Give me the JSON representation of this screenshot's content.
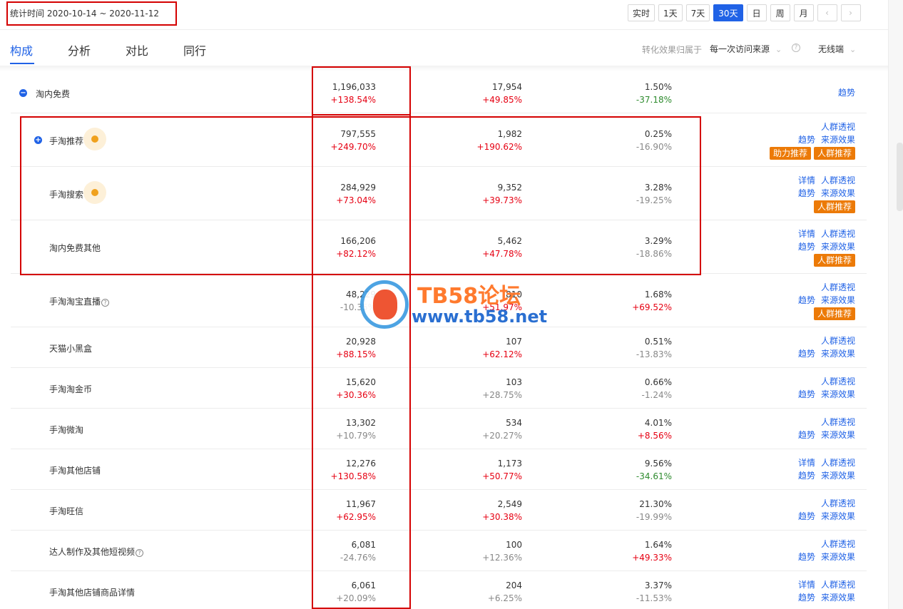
{
  "header": {
    "date_label": "统计时间 2020-10-14 ~ 2020-11-12",
    "period_buttons": [
      "实时",
      "1天",
      "7天",
      "30天",
      "日",
      "周",
      "月"
    ],
    "active_period": "30天",
    "prev_icon": "chevron-left-icon",
    "next_icon": "chevron-right-icon"
  },
  "tabs": [
    "构成",
    "分析",
    "对比",
    "同行"
  ],
  "active_tab": "构成",
  "attribution": {
    "label": "转化效果归属于",
    "value": "每一次访问来源",
    "device": "无线端"
  },
  "colors": {
    "accent": "#2062e6",
    "increase": "#e60012",
    "decrease": "#2e8b2e",
    "badge": "#ec7a07",
    "highlight": "#d40000"
  },
  "rows": [
    {
      "name": "淘内免费",
      "v1": "1,196,033",
      "c1": "+138.54%",
      "v2": "17,954",
      "c2": "+49.85%",
      "v3": "1.50%",
      "c3": "-37.18%",
      "actions": [
        "趋势"
      ]
    },
    {
      "name": "手淘推荐",
      "v1": "797,555",
      "c1": "+249.70%",
      "v2": "1,982",
      "c2": "+190.62%",
      "v3": "0.25%",
      "c3": "-16.90%",
      "actions": [
        "人群透视",
        "趋势",
        "来源效果"
      ],
      "badges": [
        "助力推荐",
        "人群推荐"
      ]
    },
    {
      "name": "手淘搜索",
      "v1": "284,929",
      "c1": "+73.04%",
      "v2": "9,352",
      "c2": "+39.73%",
      "v3": "3.28%",
      "c3": "-19.25%",
      "actions": [
        "详情",
        "人群透视",
        "趋势",
        "来源效果"
      ],
      "badges": [
        "人群推荐"
      ]
    },
    {
      "name": "淘内免费其他",
      "v1": "166,206",
      "c1": "+82.12%",
      "v2": "5,462",
      "c2": "+47.78%",
      "v3": "3.29%",
      "c3": "-18.86%",
      "actions": [
        "详情",
        "人群透视",
        "趋势",
        "来源效果"
      ],
      "badges": [
        "人群推荐"
      ]
    },
    {
      "name": "手淘淘宝直播",
      "v1": "48,229",
      "c1": "-10.35%",
      "v2": "810",
      "c2": "+51.97%",
      "v3": "1.68%",
      "c3": "+69.52%",
      "actions": [
        "人群透视",
        "趋势",
        "来源效果"
      ],
      "badges": [
        "人群推荐"
      ]
    },
    {
      "name": "天猫小黑盒",
      "v1": "20,928",
      "c1": "+88.15%",
      "v2": "107",
      "c2": "+62.12%",
      "v3": "0.51%",
      "c3": "-13.83%",
      "actions": [
        "人群透视",
        "趋势",
        "来源效果"
      ]
    },
    {
      "name": "手淘淘金币",
      "v1": "15,620",
      "c1": "+30.36%",
      "v2": "103",
      "c2": "+28.75%",
      "v3": "0.66%",
      "c3": "-1.24%",
      "actions": [
        "人群透视",
        "趋势",
        "来源效果"
      ]
    },
    {
      "name": "手淘微淘",
      "v1": "13,302",
      "c1": "+10.79%",
      "v2": "534",
      "c2": "+20.27%",
      "v3": "4.01%",
      "c3": "+8.56%",
      "actions": [
        "人群透视",
        "趋势",
        "来源效果"
      ]
    },
    {
      "name": "手淘其他店铺",
      "v1": "12,276",
      "c1": "+130.58%",
      "v2": "1,173",
      "c2": "+50.77%",
      "v3": "9.56%",
      "c3": "-34.61%",
      "actions": [
        "详情",
        "人群透视",
        "趋势",
        "来源效果"
      ]
    },
    {
      "name": "手淘旺信",
      "v1": "11,967",
      "c1": "+62.95%",
      "v2": "2,549",
      "c2": "+30.38%",
      "v3": "21.30%",
      "c3": "-19.99%",
      "actions": [
        "人群透视",
        "趋势",
        "来源效果"
      ]
    },
    {
      "name": "达人制作及其他短视频",
      "v1": "6,081",
      "c1": "-24.76%",
      "v2": "100",
      "c2": "+12.36%",
      "v3": "1.64%",
      "c3": "+49.33%",
      "actions": [
        "人群透视",
        "趋势",
        "来源效果"
      ]
    },
    {
      "name": "手淘其他店铺商品详情",
      "v1": "6,061",
      "c1": "+20.09%",
      "v2": "204",
      "c2": "+6.25%",
      "v3": "3.37%",
      "c3": "-11.53%",
      "actions": [
        "详情",
        "人群透视",
        "趋势",
        "来源效果"
      ]
    }
  ],
  "watermark": {
    "title": "TB58论坛",
    "url": "www.tb58.net"
  }
}
